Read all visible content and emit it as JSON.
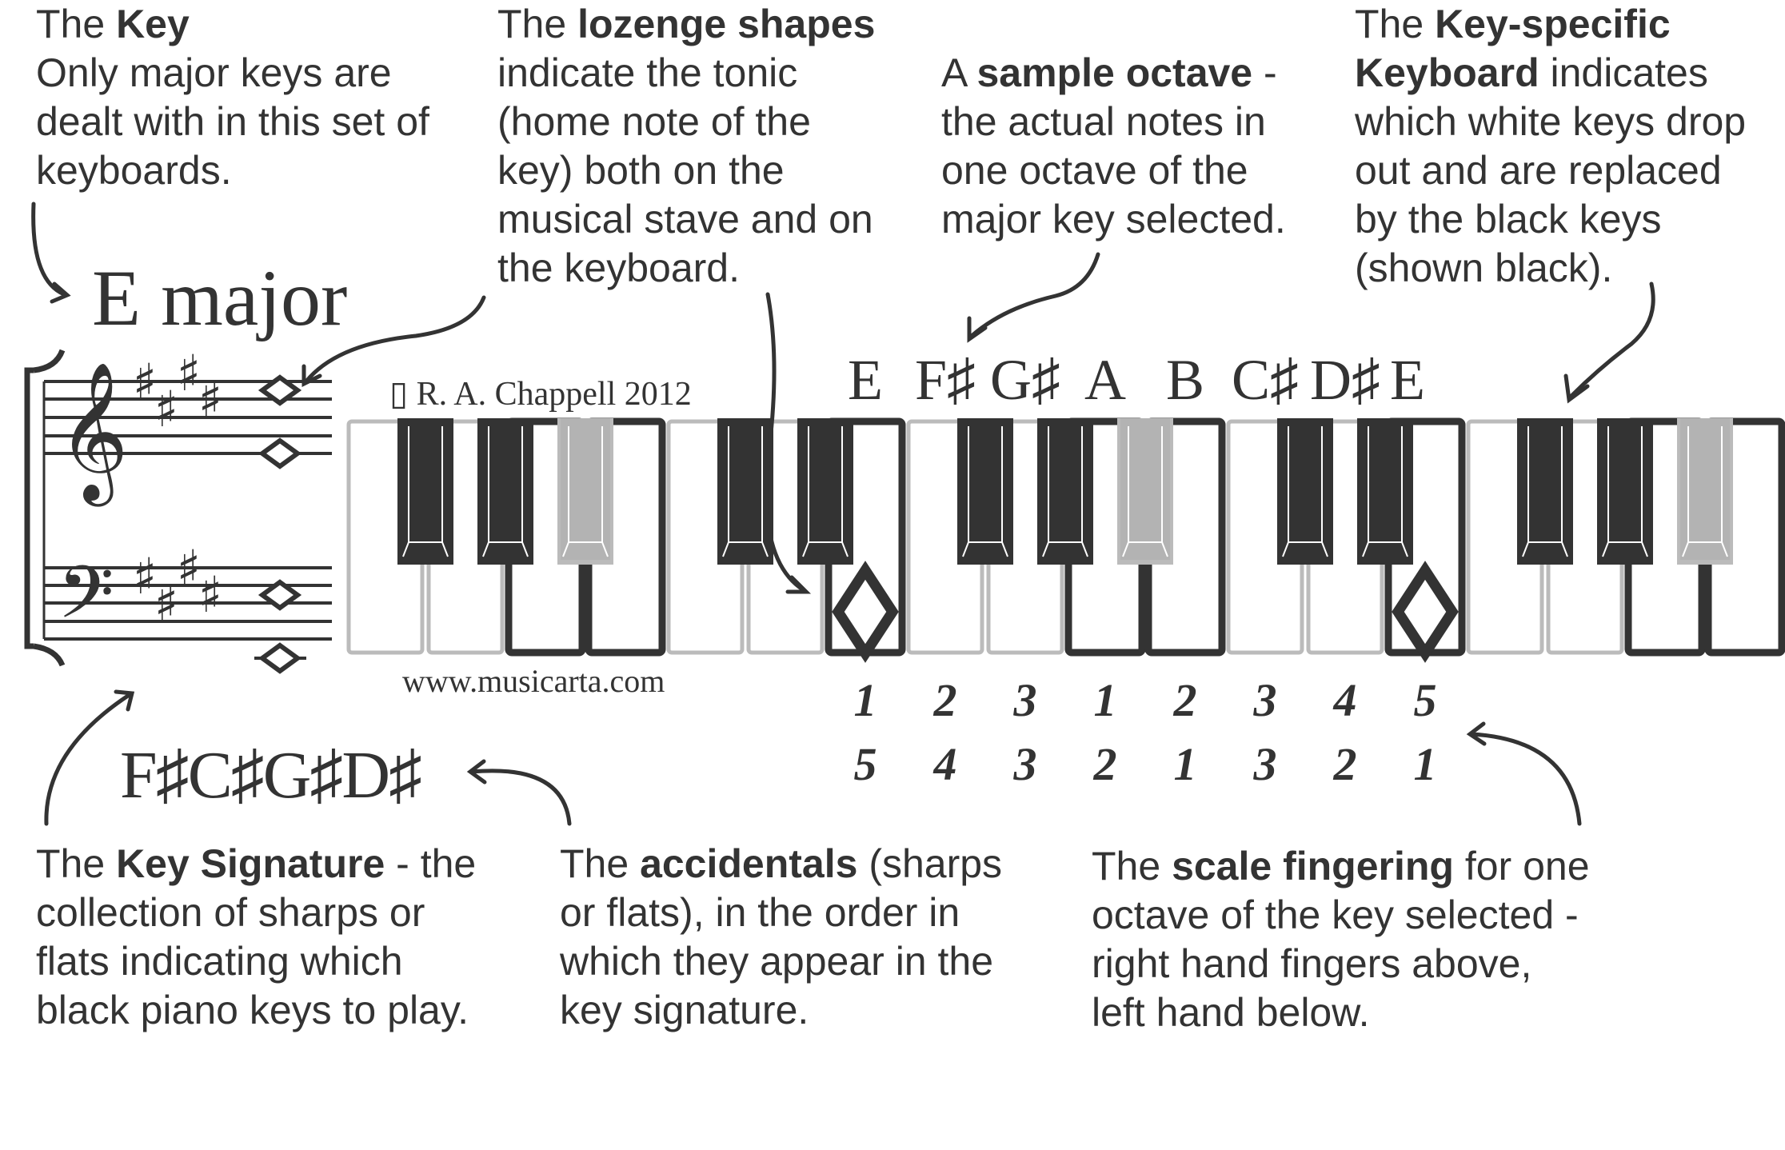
{
  "annotations": {
    "key": {
      "title_prefix": "The ",
      "title_bold": "Key",
      "lines": [
        "Only major keys are",
        "dealt with in this set of",
        "keyboards."
      ]
    },
    "lozenge": {
      "title_prefix": "The ",
      "title_bold": "lozenge shapes",
      "lines": [
        "indicate the tonic",
        "(home note of the",
        "key) both on the",
        "musical stave and on",
        "the keyboard."
      ]
    },
    "sample_octave": {
      "title_prefix": "A ",
      "title_bold": "sample octave",
      "title_suffix": " -",
      "lines": [
        "the actual notes in",
        "one octave of the",
        "major key selected."
      ]
    },
    "key_specific": {
      "title_prefix": "The ",
      "title_bold": "Key-specific",
      "line2_bold": "Keyboard",
      "line2_rest": " indicates",
      "lines": [
        "which white keys drop",
        "out and are replaced",
        "by the black keys",
        "(shown black)."
      ]
    },
    "key_signature": {
      "title_prefix": "The ",
      "title_bold": "Key Signature",
      "title_suffix": " - the",
      "lines": [
        "collection of sharps or",
        "flats indicating which",
        "black piano keys to play."
      ]
    },
    "accidentals": {
      "title_prefix": "The ",
      "title_bold": "accidentals",
      "title_suffix": " (sharps",
      "lines": [
        "or flats), in the order in",
        "which they appear in the",
        "key signature."
      ]
    },
    "fingering": {
      "title_prefix": "The ",
      "title_bold": "scale fingering",
      "title_suffix": " for one",
      "lines": [
        "octave of the key selected -",
        "right hand fingers above,",
        "left hand below."
      ]
    }
  },
  "key_name": "E major",
  "copyright": "▯ R. A. Chappell 2012",
  "website": "www.musicarta.com",
  "key_signature_accidentals": "F♯C♯G♯D♯",
  "sample_octave_notes": [
    "E",
    "F♯",
    "G♯",
    "A",
    "B",
    "C♯",
    "D♯",
    "E"
  ],
  "fingering": {
    "right_hand": [
      "1",
      "2",
      "3",
      "1",
      "2",
      "3",
      "4",
      "5"
    ],
    "left_hand": [
      "5",
      "4",
      "3",
      "2",
      "1",
      "3",
      "2",
      "1"
    ]
  },
  "keyboard": {
    "white_keys": [
      {
        "note": "F",
        "in_scale": false
      },
      {
        "note": "G",
        "in_scale": false
      },
      {
        "note": "A",
        "in_scale": true
      },
      {
        "note": "B",
        "in_scale": true
      },
      {
        "note": "C",
        "in_scale": false
      },
      {
        "note": "D",
        "in_scale": false
      },
      {
        "note": "E",
        "in_scale": true,
        "tonic": true
      },
      {
        "note": "F",
        "in_scale": false
      },
      {
        "note": "G",
        "in_scale": false
      },
      {
        "note": "A",
        "in_scale": true
      },
      {
        "note": "B",
        "in_scale": true
      },
      {
        "note": "C",
        "in_scale": false
      },
      {
        "note": "D",
        "in_scale": false
      },
      {
        "note": "E",
        "in_scale": true,
        "tonic": true
      },
      {
        "note": "F",
        "in_scale": false
      },
      {
        "note": "G",
        "in_scale": false
      },
      {
        "note": "A",
        "in_scale": true
      },
      {
        "note": "B",
        "in_scale": true
      }
    ],
    "black_keys": [
      {
        "note": "F♯",
        "after_white": 0,
        "in_scale": true
      },
      {
        "note": "G♯",
        "after_white": 1,
        "in_scale": true
      },
      {
        "note": "A♯",
        "after_white": 2,
        "in_scale": false
      },
      {
        "note": "C♯",
        "after_white": 4,
        "in_scale": true
      },
      {
        "note": "D♯",
        "after_white": 5,
        "in_scale": true
      },
      {
        "note": "F♯",
        "after_white": 7,
        "in_scale": true
      },
      {
        "note": "G♯",
        "after_white": 8,
        "in_scale": true
      },
      {
        "note": "A♯",
        "after_white": 9,
        "in_scale": false
      },
      {
        "note": "C♯",
        "after_white": 11,
        "in_scale": true
      },
      {
        "note": "D♯",
        "after_white": 12,
        "in_scale": true
      },
      {
        "note": "F♯",
        "after_white": 14,
        "in_scale": true
      },
      {
        "note": "G♯",
        "after_white": 15,
        "in_scale": true
      },
      {
        "note": "A♯",
        "after_white": 16,
        "in_scale": false
      }
    ]
  },
  "colors": {
    "ink": "#333333",
    "out_of_scale": "#bbbbbb",
    "out_of_scale_black": "#b3b3b3"
  }
}
